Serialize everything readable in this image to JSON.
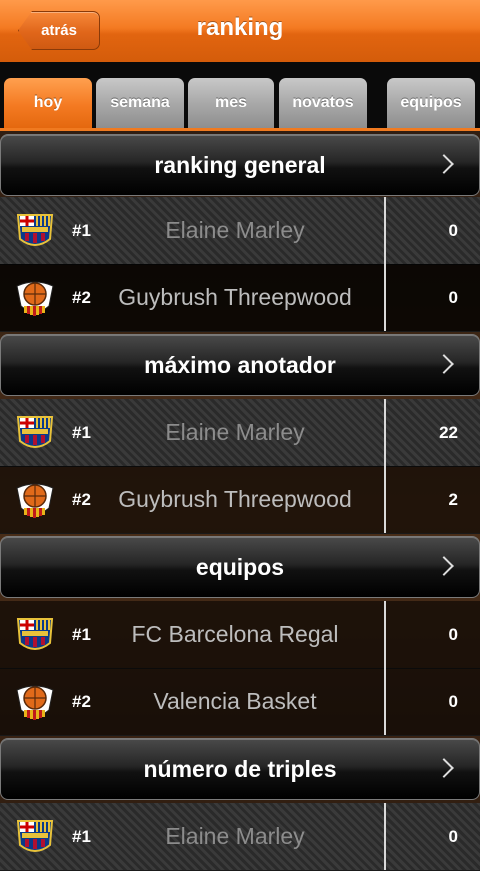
{
  "header": {
    "back_label": "atrás",
    "title": "ranking"
  },
  "tabs": [
    {
      "label": "hoy",
      "active": true
    },
    {
      "label": "semana",
      "active": false
    },
    {
      "label": "mes",
      "active": false
    },
    {
      "label": "novatos",
      "active": false
    },
    {
      "label": "equipos",
      "active": false
    }
  ],
  "sections": [
    {
      "title": "ranking general",
      "rows": [
        {
          "badge": "fc-barcelona-badge",
          "rank": "#1",
          "name": "Elaine Marley",
          "score": "0"
        },
        {
          "badge": "valencia-basket-badge",
          "rank": "#2",
          "name": "Guybrush Threepwood",
          "score": "0"
        }
      ]
    },
    {
      "title": "máximo anotador",
      "rows": [
        {
          "badge": "fc-barcelona-badge",
          "rank": "#1",
          "name": "Elaine Marley",
          "score": "22"
        },
        {
          "badge": "valencia-basket-badge",
          "rank": "#2",
          "name": "Guybrush Threepwood",
          "score": "2"
        }
      ]
    },
    {
      "title": "equipos",
      "rows": [
        {
          "badge": "fc-barcelona-badge",
          "rank": "#1",
          "name": "FC Barcelona Regal",
          "score": "0"
        },
        {
          "badge": "valencia-basket-badge",
          "rank": "#2",
          "name": "Valencia Basket",
          "score": "0"
        }
      ]
    },
    {
      "title": "número de triples",
      "rows": [
        {
          "badge": "fc-barcelona-badge",
          "rank": "#1",
          "name": "Elaine Marley",
          "score": "0"
        }
      ]
    }
  ],
  "colors": {
    "accent": "#f47a22",
    "tab_inactive": "#a9a9a9"
  }
}
